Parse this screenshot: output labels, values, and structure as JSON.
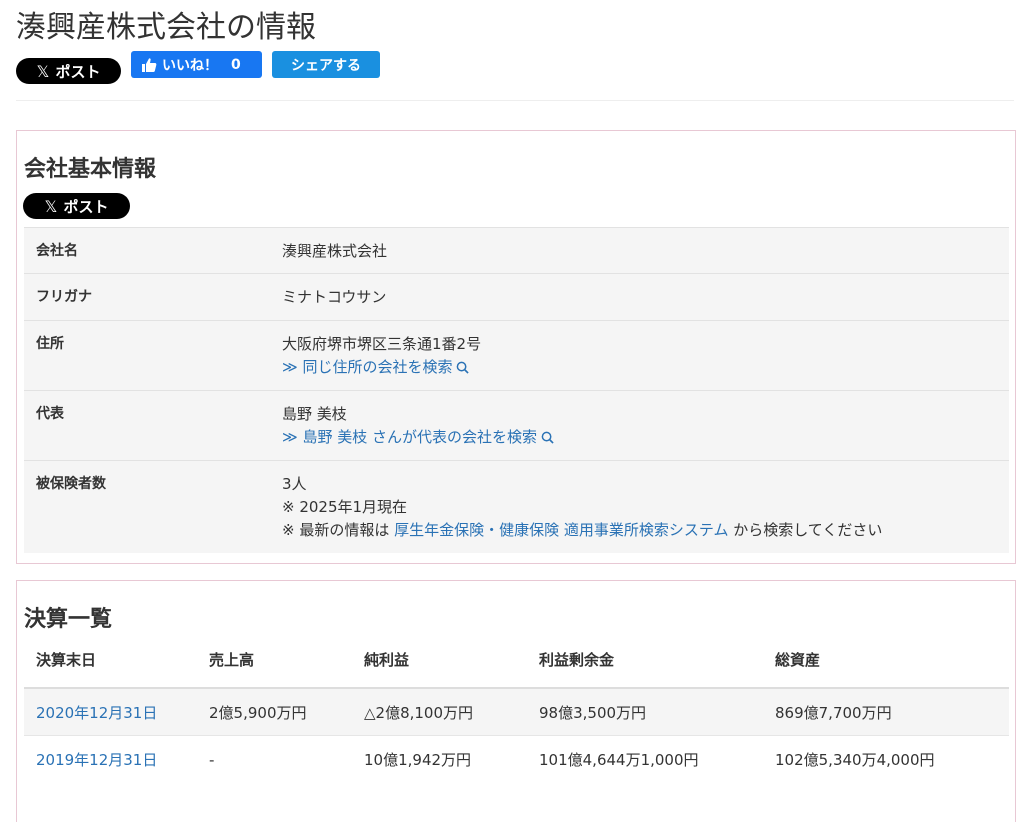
{
  "page": {
    "title": "湊興産株式会社の情報"
  },
  "share": {
    "x_label": "ポスト",
    "x_glyph": "𝕏",
    "fb_label": "いいね！",
    "fb_count": "0",
    "share_label": "シェアする",
    "fb_color": "#1877f2",
    "share_color": "#1a90e0"
  },
  "company": {
    "section_title": "会社基本情報",
    "rows": [
      {
        "label": "会社名",
        "value": "湊興産株式会社"
      },
      {
        "label": "フリガナ",
        "value": "ミナトコウサン"
      },
      {
        "label": "住所",
        "value": "大阪府堺市堺区三条通1番2号",
        "link": "≫ 同じ住所の会社を検索"
      },
      {
        "label": "代表",
        "value": "島野 美枝",
        "link": "≫ 島野 美枝 さんが代表の会社を検索"
      },
      {
        "label": "被保険者数",
        "value": "3人",
        "note1": "※ 2025年1月現在",
        "note2_prefix": "※ 最新の情報は",
        "note2_link": "厚生年金保険・健康保険 適用事業所検索システム",
        "note2_suffix": "から検索してください"
      }
    ]
  },
  "financials": {
    "section_title": "決算一覧",
    "headers": [
      "決算末日",
      "売上高",
      "純利益",
      "利益剰余金",
      "総資産"
    ],
    "rows": [
      [
        "2020年12月31日",
        "2億5,900万円",
        "△2億8,100万円",
        "98億3,500万円",
        "869億7,700万円"
      ],
      [
        "2019年12月31日",
        "-",
        "10億1,942万円",
        "101億4,644万1,000円",
        "102億5,340万4,000円"
      ]
    ]
  },
  "colors": {
    "link": "#2a72b5",
    "panel_border": "#e8c8d4"
  }
}
